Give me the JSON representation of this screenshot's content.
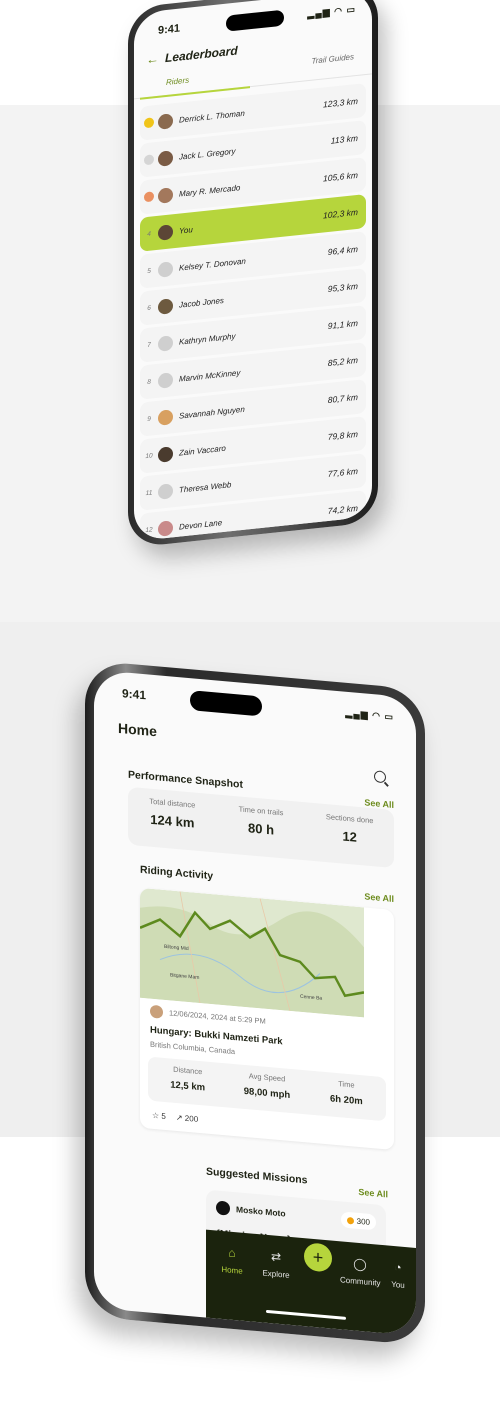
{
  "leaderboard": {
    "time": "9:41",
    "title": "Leaderboard",
    "tabs": [
      "Riders",
      "Trail Guides"
    ],
    "rows": [
      {
        "rank": "",
        "name": "Derrick L. Thoman",
        "distance": "123,3 km",
        "badge": "#f0c419"
      },
      {
        "rank": "",
        "name": "Jack L. Gregory",
        "distance": "113 km",
        "badge": "#d5d5d5"
      },
      {
        "rank": "",
        "name": "Mary R. Mercado",
        "distance": "105,6 km",
        "badge": "#ea9061"
      },
      {
        "rank": "4",
        "name": "You",
        "distance": "102,3 km",
        "highlight": true
      },
      {
        "rank": "5",
        "name": "Kelsey T. Donovan",
        "distance": "96,4 km"
      },
      {
        "rank": "6",
        "name": "Jacob Jones",
        "distance": "95,3 km"
      },
      {
        "rank": "7",
        "name": "Kathryn Murphy",
        "distance": "91,1 km"
      },
      {
        "rank": "8",
        "name": "Marvin McKinney",
        "distance": "85,2 km"
      },
      {
        "rank": "9",
        "name": "Savannah Nguyen",
        "distance": "80,7 km"
      },
      {
        "rank": "10",
        "name": "Zain Vaccaro",
        "distance": "79,8 km"
      },
      {
        "rank": "11",
        "name": "Theresa Webb",
        "distance": "77,6 km"
      },
      {
        "rank": "12",
        "name": "Devon Lane",
        "distance": "74,2 km"
      }
    ]
  },
  "home": {
    "time": "9:41",
    "title": "Home",
    "snapshot": {
      "title": "Performance Snapshot",
      "see_all": "See All",
      "stats": [
        {
          "label": "Total distance",
          "value": "124 km"
        },
        {
          "label": "Time on trails",
          "value": "80 h"
        },
        {
          "label": "Sections done",
          "value": "12"
        }
      ]
    },
    "activity": {
      "title": "Riding Activity",
      "see_all": "See All",
      "map_labels": [
        "Biltong Mid",
        "Bitgane Mam",
        "Cenne Ba"
      ],
      "date": "12/06/2024, 2024 at 5:29 PM",
      "park": "Hungary: Bukki Namzeti Park",
      "location": "British Columbia, Canada",
      "stats": [
        {
          "label": "Distance",
          "value": "12,5 km"
        },
        {
          "label": "Avg Speed",
          "value": "98,00 mph"
        },
        {
          "label": "Time",
          "value": "6h 20m"
        }
      ],
      "stars": "5",
      "shares": "200"
    },
    "missions": {
      "title": "Suggested Missions",
      "see_all": "See All",
      "brand": "Mosko Moto",
      "points": "300",
      "name": "{Mission Name}"
    },
    "nav": [
      "Home",
      "Explore",
      "Community",
      "You"
    ],
    "accent": "#b6d53c"
  }
}
